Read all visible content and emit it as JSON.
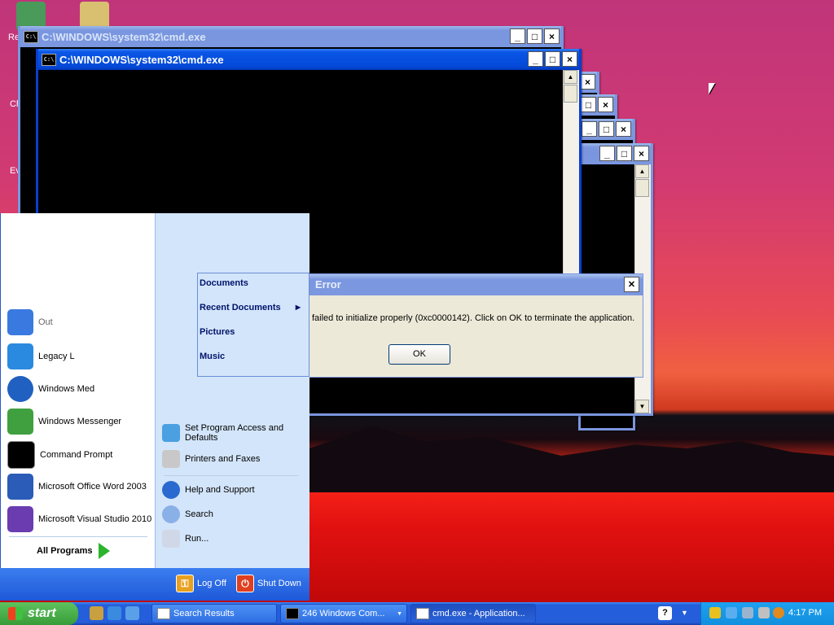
{
  "desktop": {
    "icons": [
      "recycle-bin-icon",
      "media-icon"
    ],
    "icon_labels": [
      "Re",
      "Ch",
      "Ev"
    ]
  },
  "windows": {
    "cmd_back": {
      "title": "C:\\WINDOWS\\system32\\cmd.exe"
    },
    "cmd_front": {
      "title": "C:\\WINDOWS\\system32\\cmd.exe"
    }
  },
  "dialog": {
    "title": "Error",
    "message": "failed to initialize properly (0xc0000142). Click on OK to terminate the application.",
    "ok_label": "OK",
    "close_glyph": "✕"
  },
  "submenu": {
    "items": [
      {
        "label": "Documents"
      },
      {
        "label": "Recent Documents"
      },
      {
        "label": "Pictures"
      },
      {
        "label": "Music"
      }
    ]
  },
  "start_menu": {
    "left_items": [
      {
        "label": "Out",
        "icon": "outlook-icon"
      },
      {
        "label": "Legacy L",
        "icon": "update-icon"
      },
      {
        "label": "Windows Med",
        "icon": "media-player-icon"
      },
      {
        "label": "Windows Messenger",
        "icon": "messenger-icon"
      },
      {
        "label": "Command Prompt",
        "icon": "command-prompt-icon"
      },
      {
        "label": "Microsoft Office Word 2003",
        "icon": "word-icon"
      },
      {
        "label": "Microsoft Visual Studio 2010",
        "icon": "visual-studio-icon"
      }
    ],
    "all_programs": "All Programs",
    "right_items": [
      {
        "label": "Set Program Access and Defaults",
        "icon": "program-access-icon"
      },
      {
        "label": "Printers and Faxes",
        "icon": "printer-icon"
      },
      {
        "label": "Help and Support",
        "icon": "help-icon"
      },
      {
        "label": "Search",
        "icon": "search-icon"
      },
      {
        "label": "Run...",
        "icon": "run-icon"
      }
    ],
    "log_off": "Log Off",
    "shut_down": "Shut Down"
  },
  "taskbar": {
    "start_label": "start",
    "tasks": [
      {
        "label": "Search Results"
      },
      {
        "label": "246 Windows Com..."
      },
      {
        "label": "cmd.exe - Application..."
      }
    ],
    "clock": "4:17 PM"
  },
  "colors": {
    "taskbar_blue": "#245edb",
    "start_green": "#389c38",
    "title_active": "#0349d8",
    "title_inactive": "#7b97e0"
  }
}
